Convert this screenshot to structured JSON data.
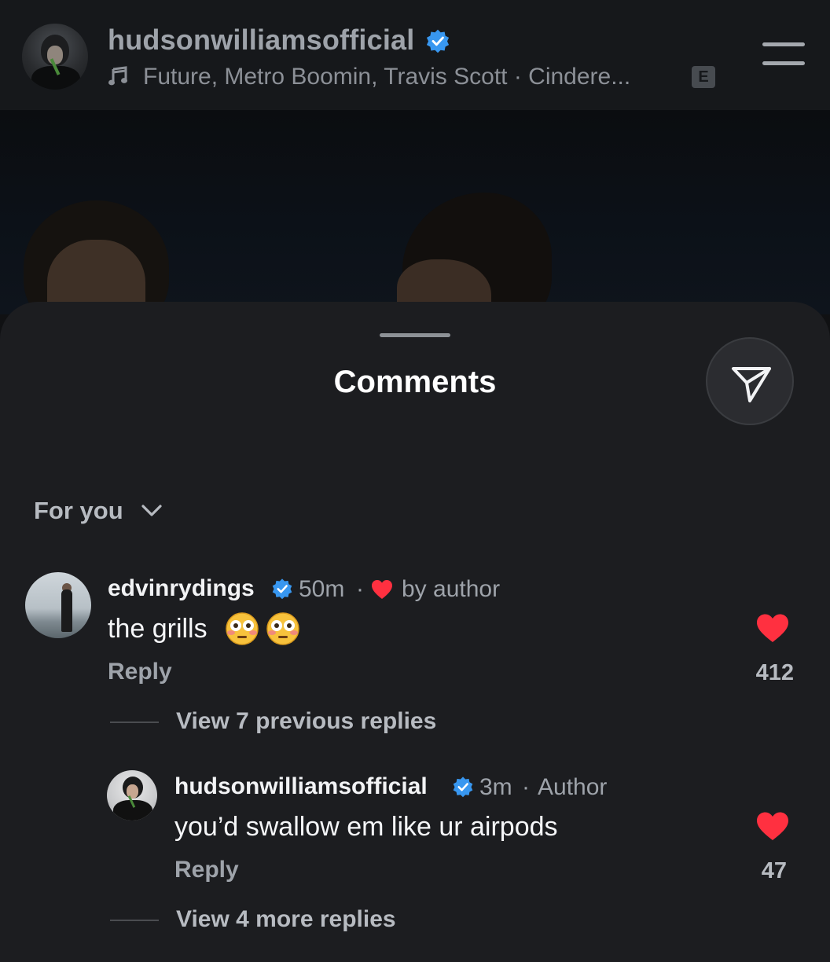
{
  "header": {
    "username": "hudsonwilliamsofficial",
    "music_text": "Future, Metro Boomin, Travis Scott · Cindere...",
    "explicit_badge": "E",
    "icons": [
      "avatar",
      "verified-badge-icon",
      "music-note-icon",
      "menu-icon"
    ]
  },
  "sheet": {
    "title": "Comments",
    "share_icon": "send-icon",
    "sort_label": "For you"
  },
  "comments": [
    {
      "username": "edvinrydings",
      "time": "50m",
      "meta_sep": "·",
      "liked_by_author": "by author",
      "text": "the grills",
      "emoji": [
        "flushed-face",
        "flushed-face"
      ],
      "reply_label": "Reply",
      "likes": "412",
      "view_replies": "View 7 previous replies"
    },
    {
      "username": "hudsonwilliamsofficial",
      "time": "3m",
      "meta_sep": "·",
      "role": "Author",
      "text": "you’d swallow em like ur airpods",
      "reply_label": "Reply",
      "likes": "47",
      "view_replies": "View 4 more replies"
    }
  ],
  "colors": {
    "heart": "#ff3040",
    "verified": "#3897f0",
    "sheet_bg": "#1c1d20"
  }
}
